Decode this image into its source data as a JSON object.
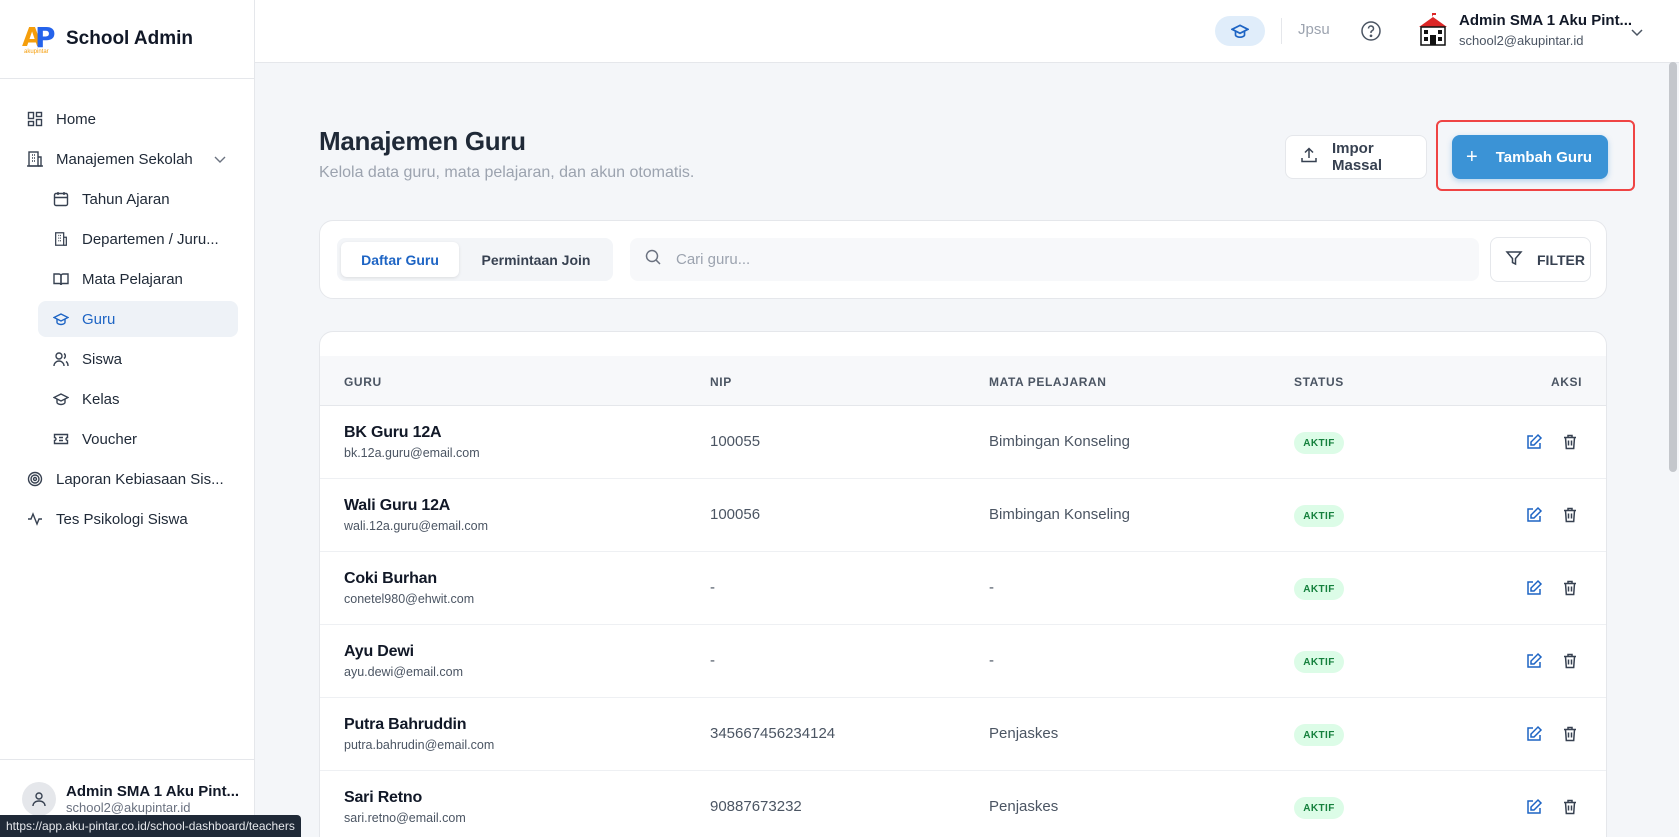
{
  "brand": {
    "title": "School Admin",
    "logo_sub": "akupintar"
  },
  "sidebar": {
    "items": [
      {
        "label": "Home",
        "icon": "grid-icon"
      },
      {
        "label": "Manajemen Sekolah",
        "icon": "building-icon"
      },
      {
        "label": "Tahun Ajaran",
        "icon": "calendar-icon"
      },
      {
        "label": "Departemen / Juru...",
        "icon": "building-icon"
      },
      {
        "label": "Mata Pelajaran",
        "icon": "book-icon"
      },
      {
        "label": "Guru",
        "icon": "graduation-cap-icon"
      },
      {
        "label": "Siswa",
        "icon": "users-icon"
      },
      {
        "label": "Kelas",
        "icon": "graduation-cap-icon"
      },
      {
        "label": "Voucher",
        "icon": "ticket-icon"
      },
      {
        "label": "Laporan Kebiasaan Sis...",
        "icon": "target-icon"
      },
      {
        "label": "Tes Psikologi Siswa",
        "icon": "activity-icon"
      }
    ],
    "user": {
      "name": "Admin SMA 1 Aku Pint...",
      "email": "school2@akupintar.id"
    }
  },
  "statusbar": {
    "url": "https://app.aku-pintar.co.id/school-dashboard/teachers"
  },
  "topbar": {
    "name": "Jpsu",
    "user_name": "Admin SMA 1 Aku Pint...",
    "user_email": "school2@akupintar.id"
  },
  "page": {
    "title": "Manajemen Guru",
    "subtitle": "Kelola data guru, mata pelajaran, dan akun otomatis.",
    "impor_label": "Impor Massal",
    "tambah_label": "Tambah Guru"
  },
  "toolbar": {
    "tab_active": "Daftar Guru",
    "tab_second": "Permintaan Join",
    "search_placeholder": "Cari guru...",
    "filter_label": "FILTER"
  },
  "table": {
    "headers": {
      "guru": "GURU",
      "nip": "NIP",
      "mapel": "MATA PELAJARAN",
      "status": "STATUS",
      "aksi": "AKSI"
    },
    "rows": [
      {
        "name": "BK Guru 12A",
        "email": "bk.12a.guru@email.com",
        "nip": "100055",
        "mapel": "Bimbingan Konseling",
        "status": "AKTIF"
      },
      {
        "name": "Wali Guru 12A",
        "email": "wali.12a.guru@email.com",
        "nip": "100056",
        "mapel": "Bimbingan Konseling",
        "status": "AKTIF"
      },
      {
        "name": "Coki Burhan",
        "email": "conetel980@ehwit.com",
        "nip": "-",
        "mapel": "-",
        "status": "AKTIF"
      },
      {
        "name": "Ayu Dewi",
        "email": "ayu.dewi@email.com",
        "nip": "-",
        "mapel": "-",
        "status": "AKTIF"
      },
      {
        "name": "Putra Bahruddin",
        "email": "putra.bahrudin@email.com",
        "nip": "345667456234124",
        "mapel": "Penjaskes",
        "status": "AKTIF"
      },
      {
        "name": "Sari Retno",
        "email": "sari.retno@email.com",
        "nip": "90887673232",
        "mapel": "Penjaskes",
        "status": "AKTIF"
      }
    ]
  },
  "colors": {
    "accent": "#3b93d6",
    "active_text": "#1d64c4",
    "badge_bg": "#dcfce7",
    "badge_text": "#15803d",
    "highlight": "#ef4444"
  }
}
